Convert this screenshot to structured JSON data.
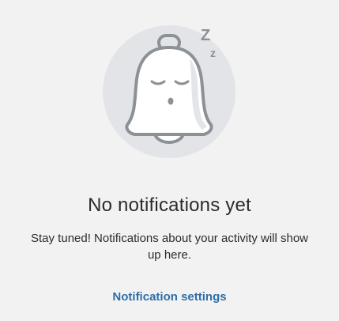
{
  "empty_state": {
    "illustration_icon": "sleeping-bell-icon",
    "sleep_letters": [
      "Z",
      "z"
    ],
    "title": "No notifications yet",
    "message": "Stay tuned! Notifications about your activity will show up here.",
    "settings_link_label": "Notification settings"
  },
  "colors": {
    "background": "#f2f2f2",
    "circle": "#e2e4e8",
    "bell_fill": "#ffffff",
    "bell_stroke": "#8c9196",
    "text": "#2b2b2b",
    "link": "#2f6ea8"
  }
}
